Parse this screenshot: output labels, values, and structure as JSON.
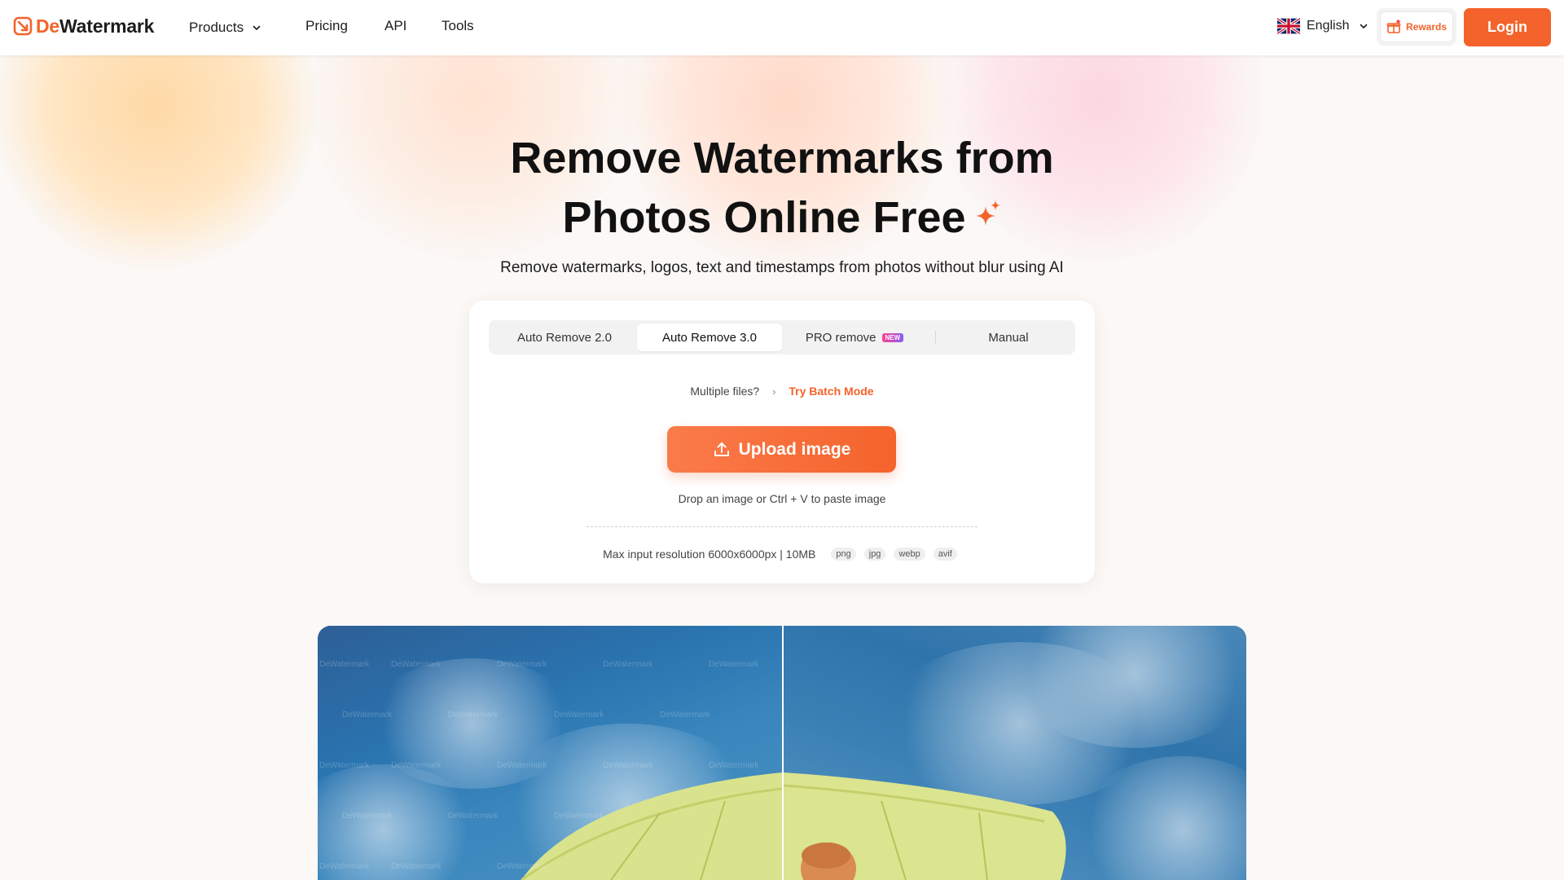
{
  "brand": {
    "name_part1": "De",
    "name_part2": "Watermark",
    "accent": "#f4632b"
  },
  "nav": {
    "products": "Products",
    "pricing": "Pricing",
    "api": "API",
    "tools": "Tools"
  },
  "language": {
    "label": "English",
    "flag": "uk-flag-icon"
  },
  "rewards_label": "Rewards",
  "login_label": "Login",
  "hero": {
    "title_line1": "Remove Watermarks from",
    "title_line2": "Photos Online Free",
    "subtitle": "Remove watermarks, logos, text and timestamps from photos without blur using AI"
  },
  "tabs": [
    {
      "label": "Auto Remove 2.0",
      "active": false
    },
    {
      "label": "Auto Remove 3.0",
      "active": true
    },
    {
      "label": "PRO remove",
      "badge": "NEW",
      "active": false
    },
    {
      "label": "Manual",
      "active": false
    }
  ],
  "batch": {
    "question": "Multiple files?",
    "link": "Try Batch Mode"
  },
  "upload": {
    "button": "Upload image",
    "hint": "Drop an image or Ctrl + V to paste image",
    "limits": "Max input resolution 6000x6000px | 10MB",
    "formats": [
      "png",
      "jpg",
      "webp",
      "avif"
    ]
  },
  "preview": {
    "watermark_text": "DeWatermark"
  }
}
